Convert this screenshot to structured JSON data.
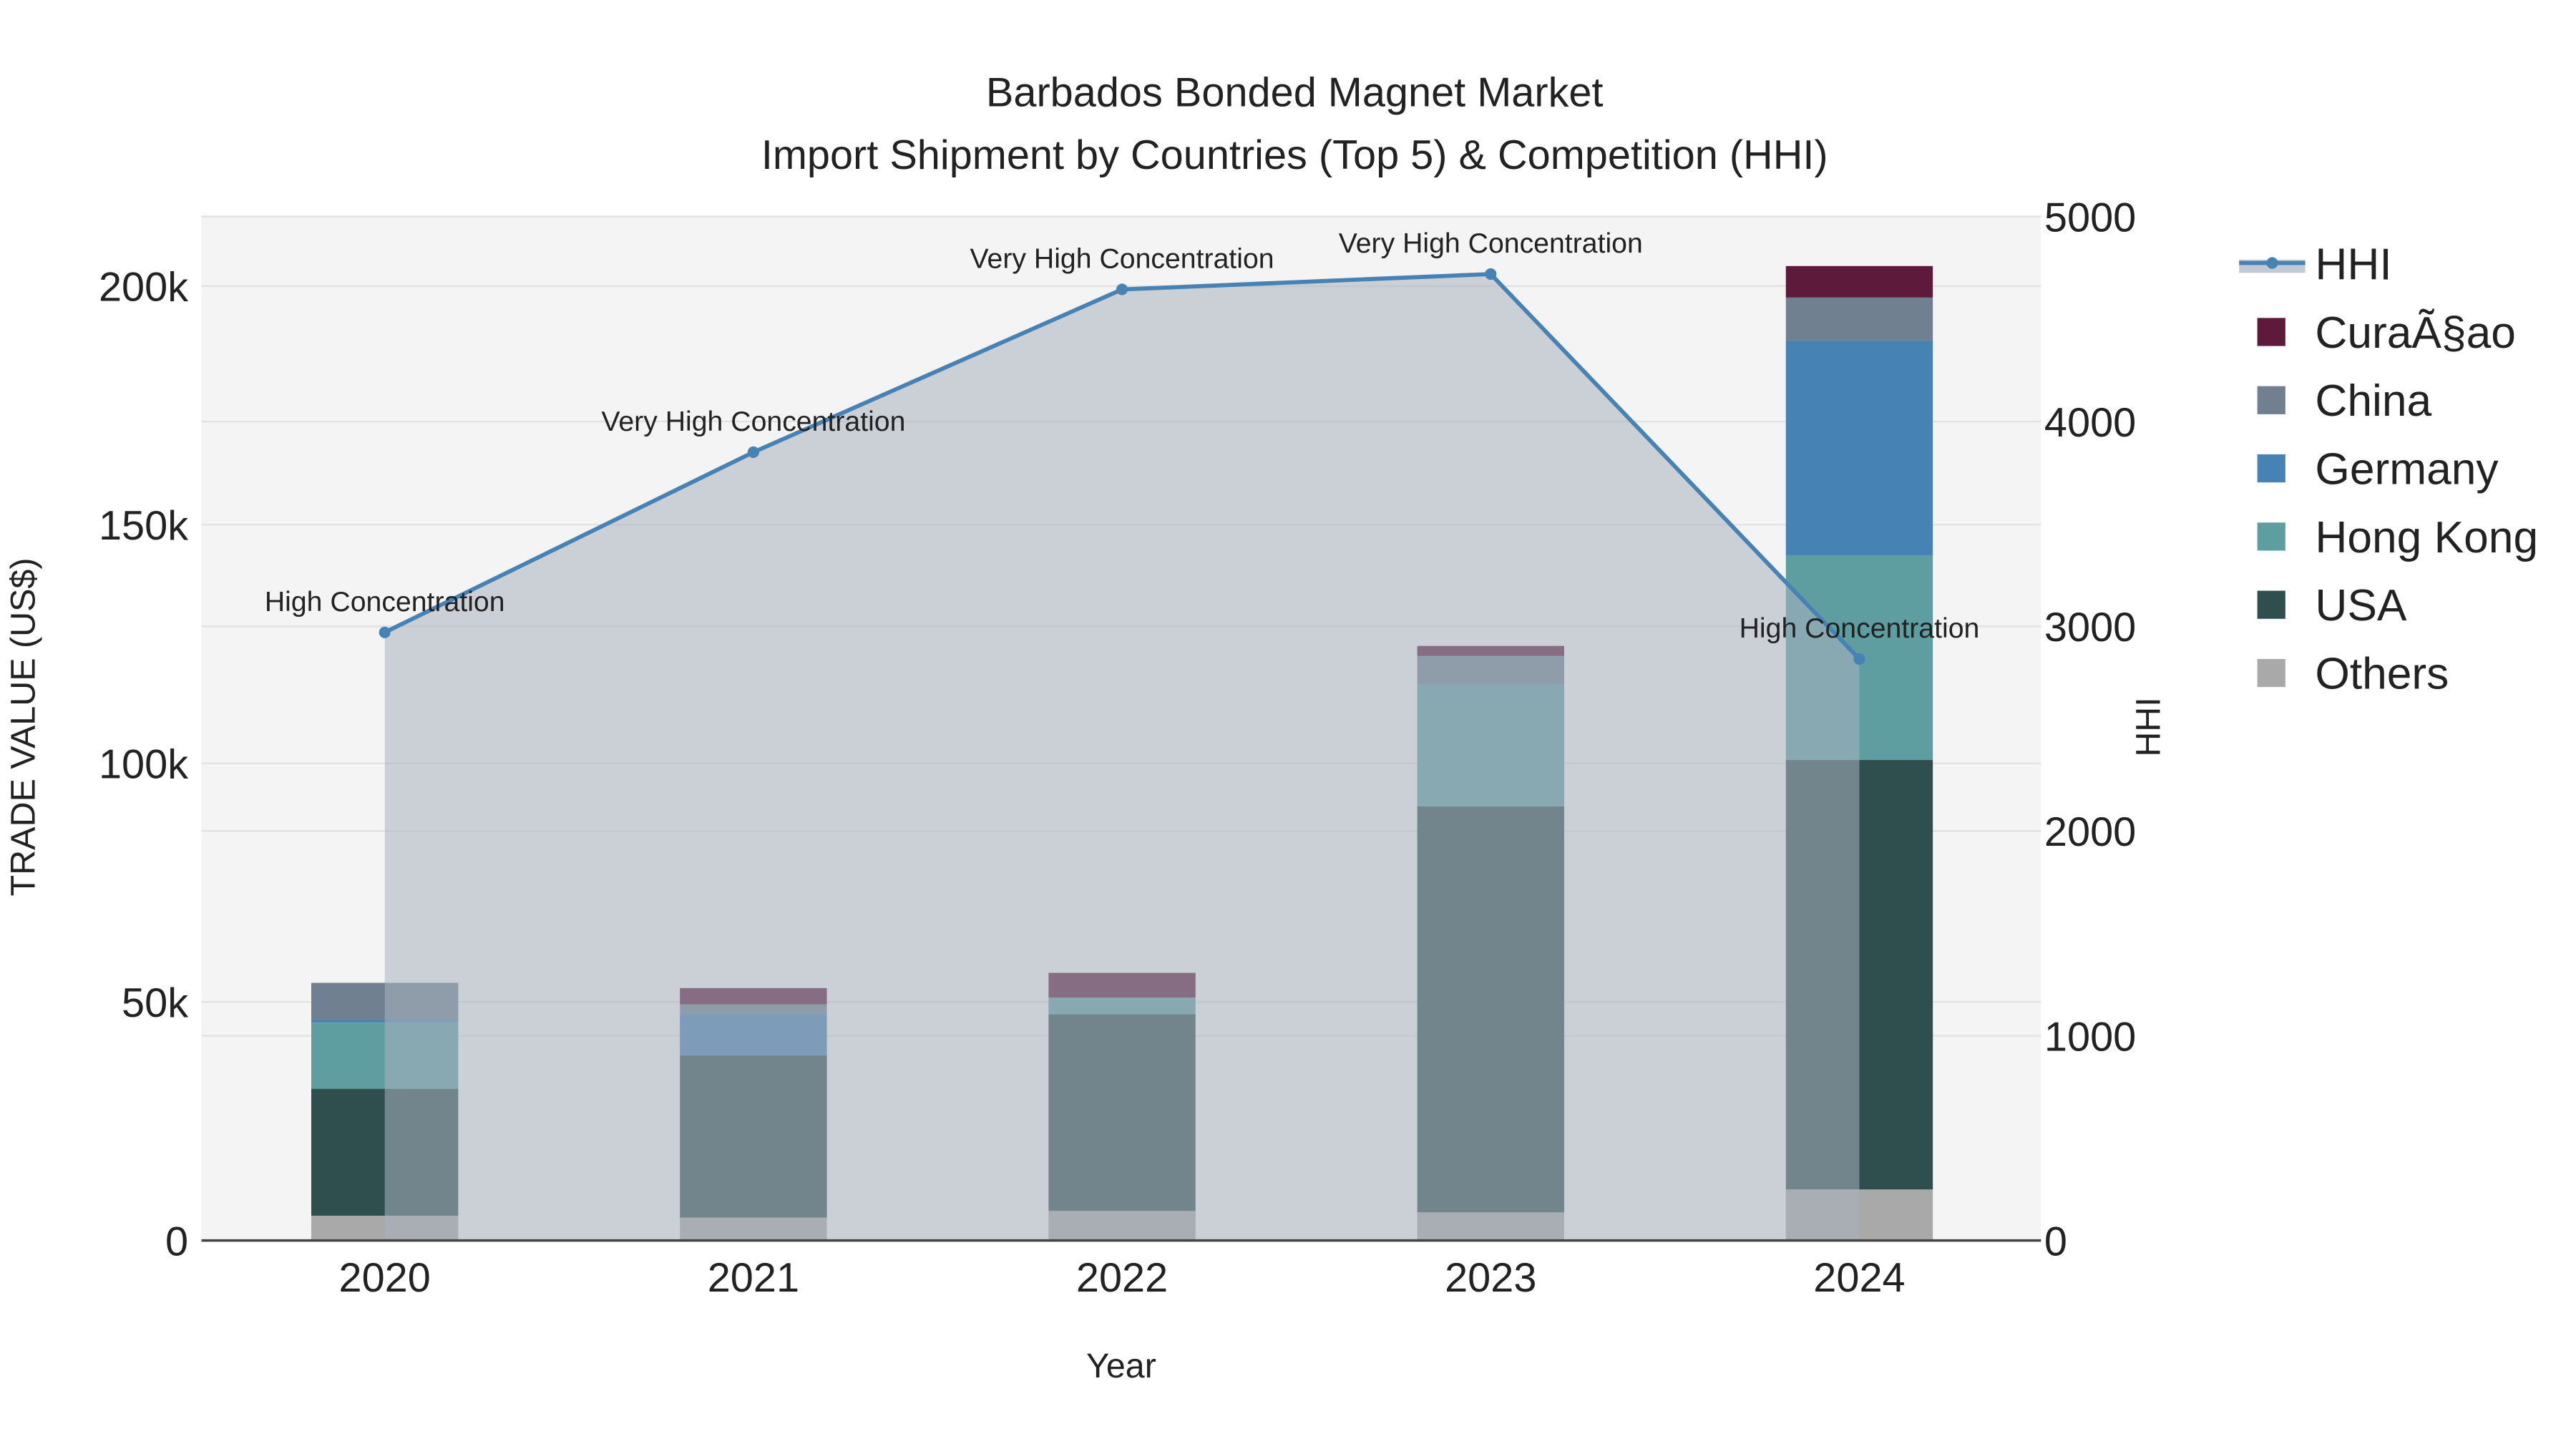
{
  "chart_data": {
    "type": "bar",
    "title": "Barbados Bonded Magnet Market",
    "subtitle": "Import Shipment by Countries (Top 5) & Competition (HHI)",
    "xlabel": "Year",
    "ylabel": "TRADE VALUE (US$)",
    "y2label": "HHI",
    "categories": [
      "2020",
      "2021",
      "2022",
      "2023",
      "2024"
    ],
    "ylim": [
      0,
      215000
    ],
    "y2lim": [
      0,
      5000
    ],
    "yticks": [
      0,
      50000,
      100000,
      150000,
      200000
    ],
    "ytick_labels": [
      "0",
      "50k",
      "100k",
      "150k",
      "200k"
    ],
    "y2ticks": [
      0,
      1000,
      2000,
      3000,
      4000,
      5000
    ],
    "y2tick_labels": [
      "0",
      "1000",
      "2000",
      "3000",
      "4000",
      "5000"
    ],
    "legend_position": "right",
    "series": [
      {
        "name": "Others",
        "color": "#a9a9a9",
        "values": [
          5200,
          4800,
          6200,
          5900,
          10700
        ]
      },
      {
        "name": "USA",
        "color": "#2f4f4f",
        "values": [
          26600,
          34000,
          41200,
          85100,
          90000
        ]
      },
      {
        "name": "Hong Kong",
        "color": "#5f9ea0",
        "values": [
          13900,
          0,
          3500,
          25600,
          42900
        ]
      },
      {
        "name": "Germany",
        "color": "#4682b4",
        "values": [
          500,
          8600,
          0,
          0,
          45000
        ]
      },
      {
        "name": "China",
        "color": "#708090",
        "values": [
          7800,
          2100,
          0,
          5900,
          9000
        ]
      },
      {
        "name": "CuraÃ§ao",
        "color": "#5e1a3b",
        "values": [
          0,
          3400,
          5200,
          2100,
          6600
        ]
      }
    ],
    "hhi": {
      "name": "HHI",
      "color": "#4682b4",
      "values": [
        2970,
        3850,
        4645,
        4720,
        2840
      ],
      "annotations": [
        "High Concentration",
        "Very High Concentration",
        "Very High Concentration",
        "Very High Concentration",
        "High Concentration"
      ]
    },
    "legend_order": [
      "HHI",
      "CuraÃ§ao",
      "China",
      "Germany",
      "Hong Kong",
      "USA",
      "Others"
    ]
  }
}
